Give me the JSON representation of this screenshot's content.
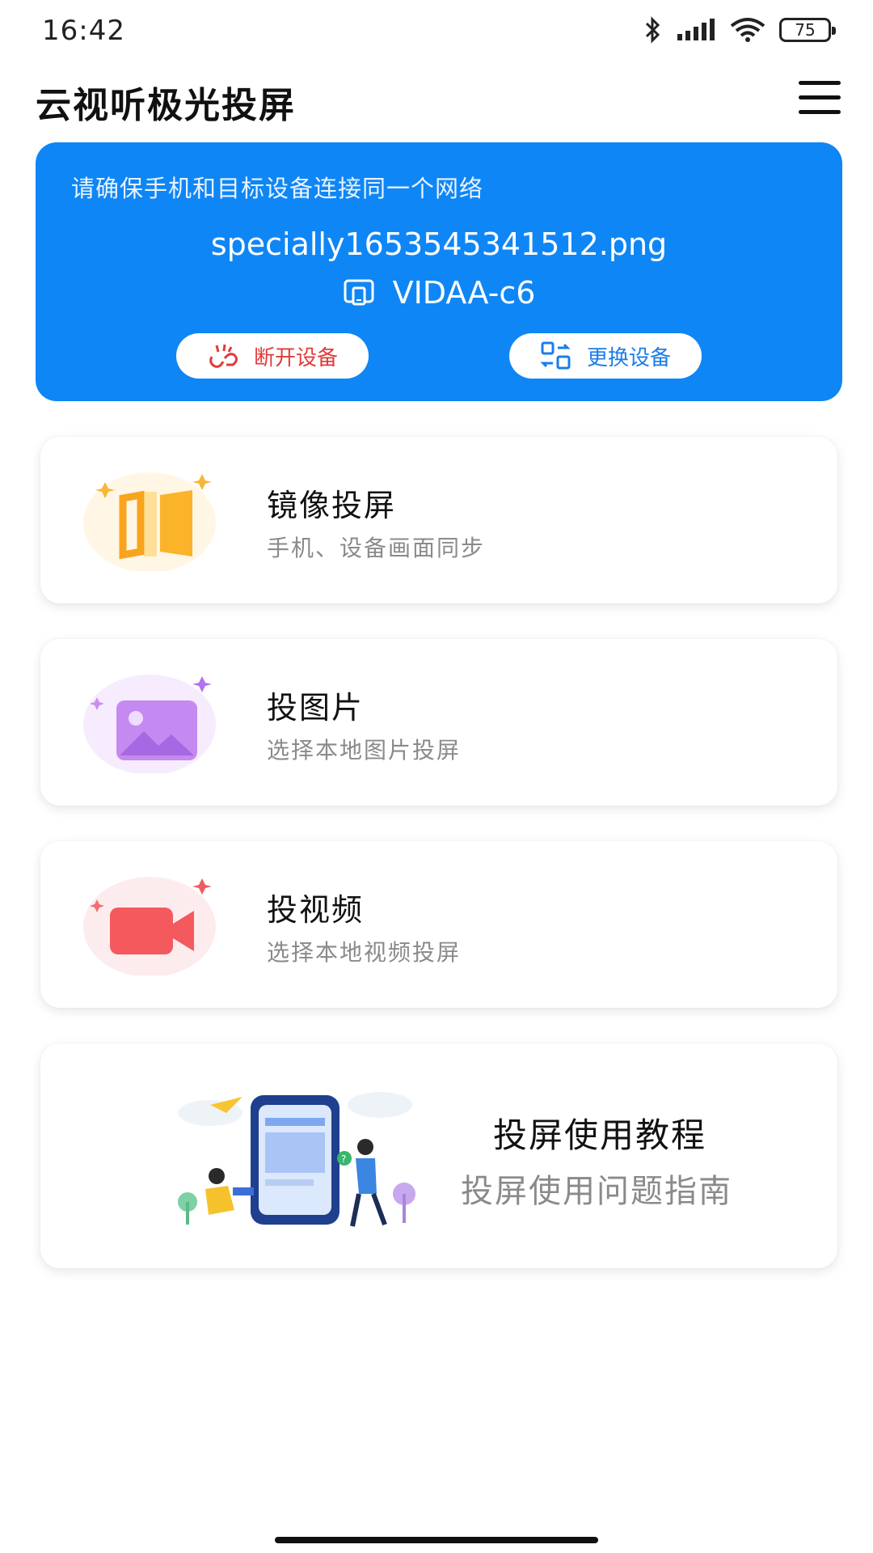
{
  "status_bar": {
    "time": "16:42",
    "battery": "75",
    "icons": [
      "bluetooth-icon",
      "signal-icon",
      "wifi-icon",
      "battery-icon"
    ]
  },
  "app": {
    "title": "云视听极光投屏"
  },
  "connection": {
    "hint": "请确保手机和目标设备连接同一个网络",
    "file_name": "specially1653545341512.png",
    "device_name": "VIDAA-c6",
    "disconnect_label": "断开设备",
    "switch_label": "更换设备"
  },
  "features": [
    {
      "title": "镜像投屏",
      "subtitle": "手机、设备画面同步",
      "icon": "mirror-icon"
    },
    {
      "title": "投图片",
      "subtitle": "选择本地图片投屏",
      "icon": "picture-icon"
    },
    {
      "title": "投视频",
      "subtitle": "选择本地视频投屏",
      "icon": "video-camera-icon"
    }
  ],
  "tutorial": {
    "title": "投屏使用教程",
    "subtitle": "投屏使用问题指南",
    "icon": "tutorial-illustration"
  },
  "colors": {
    "primary_blue": "#0f86f5",
    "disconnect_red": "#e23a3a",
    "switch_blue": "#1a7de8",
    "subtitle_gray": "#8a8a8a"
  }
}
